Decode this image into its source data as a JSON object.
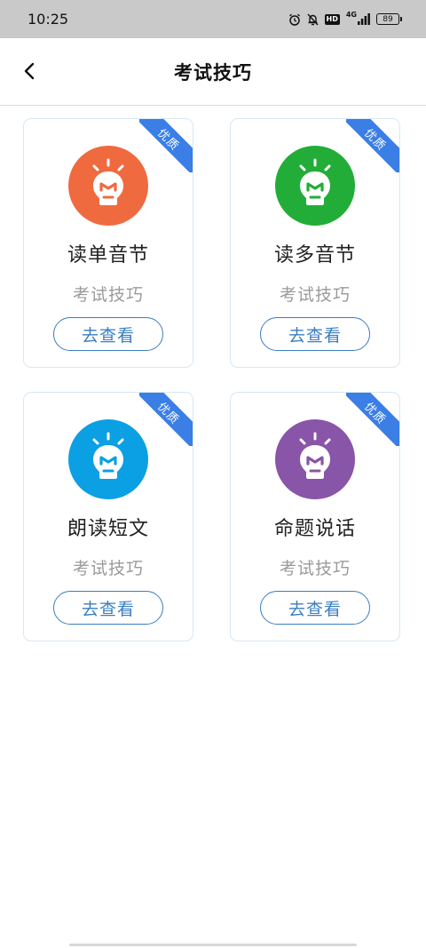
{
  "status_bar": {
    "time": "10:25",
    "network": "4G",
    "hd": "HD",
    "battery": "89"
  },
  "header": {
    "title": "考试技巧",
    "back_icon": "chevron-left-icon"
  },
  "colors": {
    "ribbon": "#3a7ee6",
    "button": "#3a7ec2",
    "card_border": "#d6e8f5"
  },
  "cards": [
    {
      "badge": "优质",
      "title": "读单音节",
      "subtitle": "考试技巧",
      "button": "去查看",
      "color": "#f06a40",
      "icon": "lightbulb-icon"
    },
    {
      "badge": "优质",
      "title": "读多音节",
      "subtitle": "考试技巧",
      "button": "去查看",
      "color": "#22ad38",
      "icon": "lightbulb-icon"
    },
    {
      "badge": "优质",
      "title": "朗读短文",
      "subtitle": "考试技巧",
      "button": "去查看",
      "color": "#0ba0e4",
      "icon": "lightbulb-icon"
    },
    {
      "badge": "优质",
      "title": "命题说话",
      "subtitle": "考试技巧",
      "button": "去查看",
      "color": "#8855a8",
      "icon": "lightbulb-icon"
    }
  ]
}
